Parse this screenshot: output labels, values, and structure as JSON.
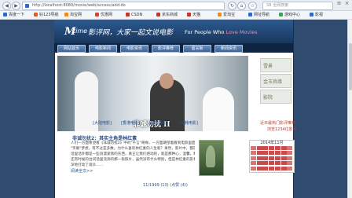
{
  "browser": {
    "url": "http://localhost:8080/movie/web/access/add.do",
    "search_placeholder": "SB 全网搜索",
    "bookmarks": [
      {
        "label": "百度一下",
        "color": "#2f6bc3"
      },
      {
        "label": "好123导航",
        "color": "#e05a2b"
      },
      {
        "label": "淘宝网",
        "color": "#f08a1c"
      },
      {
        "label": "优惠网",
        "color": "#d9432f"
      },
      {
        "label": "CSDN",
        "color": "#c0392b"
      },
      {
        "label": "京东商城",
        "color": "#c0392b"
      },
      {
        "label": "天猫",
        "color": "#c0392b"
      },
      {
        "label": "爱淘宝",
        "color": "#f08a1c"
      },
      {
        "label": "网址导航",
        "color": "#2f6bc3"
      },
      {
        "label": "游戏中心",
        "color": "#3aa55a"
      },
      {
        "label": "影视",
        "color": "#2f6bc3"
      }
    ]
  },
  "site": {
    "logo_m": "M",
    "logo_time": "time",
    "slogan_cn": "影评网，大家一起文说电影",
    "slogan_en_pre": "For People Who ",
    "slogan_en_hl": "Love Movies"
  },
  "menu": [
    "网站首页",
    "电影新闻",
    "电影资讯",
    "影评推荐",
    "留言板",
    "新闻资讯"
  ],
  "banner": {
    "caption": "非诚勿扰 II"
  },
  "side_thumbs": [
    "雪景",
    "金玉良缘",
    "影院"
  ],
  "tabs": [
    "[大陆电影]",
    "[香港电影]",
    "[欧美电影]",
    "[日韩电影]"
  ],
  "sidebar": {
    "recent_title": "近日最热门影评推荐",
    "recent_count": "浏览1234位影评",
    "calendar_title": "2014年11月"
  },
  "article": {
    "title": "非诚勿扰2：其实主角是林红素",
    "lines": [
      "人们一方面希望看《非诚勿扰2》中的\"千言\"奇缘，一方面期望着看到电影里面的",
      "\"笑眼\"梦想，有不过是多数。为什么喜欢林红素的人生呢？果然，影片中，都是选择面对，",
      "话里话外都是一些浪漫爱情的东西，真正让我们感动的，就是那种心，温馨。精彩，特别",
      "还有时候的台词话里流淌的那一张照片，虽然没有什么特别，但是林红素的形象还是深",
      "深地打动了观众……"
    ],
    "readmore": "阅读全文>>",
    "pager": "11/1999 (10) (点赞 (4))"
  }
}
